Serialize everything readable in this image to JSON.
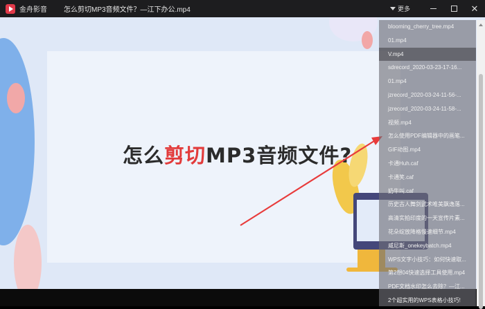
{
  "titlebar": {
    "app_name": "金舟影音",
    "file_title": "怎么剪切MP3音频文件？—江下办公.mp4",
    "more_label": "更多",
    "close_glyph": "✕"
  },
  "video": {
    "headline_part1": "怎么",
    "headline_red": "剪切",
    "headline_part2": "MP3音频文件?"
  },
  "playlist": {
    "items": [
      "blooming_cherry_tree.mp4",
      "01.mp4",
      "V.mp4",
      "sdrecord_2020-03-23-17-16...",
      "01.mp4",
      "jzrecord_2020-03-24-11-56-...",
      "jzrecord_2020-03-24-11-58-...",
      "视频.mp4",
      "怎么使用PDF编辑器中的画笔...",
      "GIF动图.mp4",
      "卡通Huh.caf",
      "卡通笑.caf",
      "奶牛叫.caf",
      "历史古人舞剑武术唯美飘逸落...",
      "高清实拍印度的一天宣传片素...",
      "花朵绽放降格慢速细节.mp4",
      "威尼斯_onekeybatch.mp4",
      "WPS文字小技巧：如何快速取...",
      "第2想04快速选择工具使用.mp4",
      "PDF文档水印怎么去除？—江...",
      "2个超实用的WPS表格小技巧!"
    ],
    "selected_index": 2
  },
  "colors": {
    "accent_red": "#e23b3b",
    "titlebar_bg": "#1d1d1f",
    "video_bg": "#dfe8f7"
  }
}
